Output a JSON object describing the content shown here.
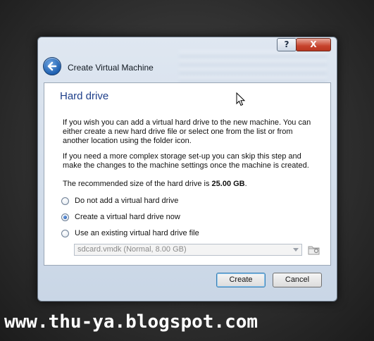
{
  "window": {
    "title": "Create Virtual Machine",
    "help_label": "?",
    "close_label": "X"
  },
  "page": {
    "heading": "Hard drive",
    "para1": "If you wish you can add a virtual hard drive to the new machine. You can either create a new hard drive file or select one from the list or from another location using the folder icon.",
    "para2": "If you need a more complex storage set-up you can skip this step and make the changes to the machine settings once the machine is created.",
    "para3_prefix": "The recommended size of the hard drive is ",
    "para3_size": "25.00 GB",
    "para3_suffix": "."
  },
  "options": [
    {
      "label": "Do not add a virtual hard drive",
      "selected": false
    },
    {
      "label": "Create a virtual hard drive now",
      "selected": true
    },
    {
      "label": "Use an existing virtual hard drive file",
      "selected": false
    }
  ],
  "existing_file_combo": {
    "value": "sdcard.vmdk (Normal, 8.00 GB)",
    "enabled": false
  },
  "buttons": {
    "create": "Create",
    "cancel": "Cancel"
  },
  "watermark": "www.thu-ya.blogspot.com",
  "icons": {
    "back": "back-arrow-icon",
    "folder": "folder-icon",
    "cursor": "mouse-cursor-icon"
  }
}
